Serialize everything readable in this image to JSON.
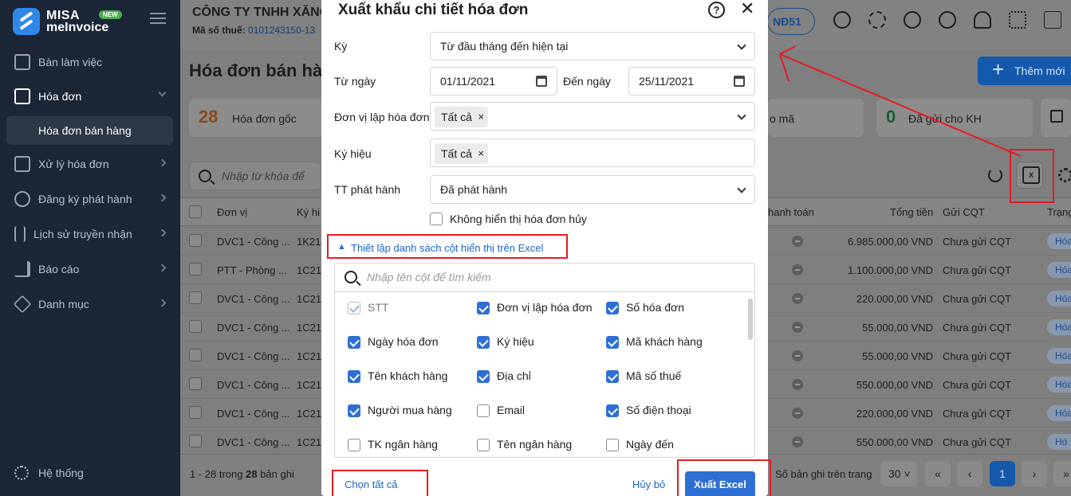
{
  "app": {
    "brand_line1": "MISA",
    "brand_line2": "meInvoice",
    "badge": "NEW"
  },
  "sidebar": {
    "items": [
      {
        "label": "Bàn làm việc",
        "icon": "monitor-icon"
      },
      {
        "label": "Hóa đơn",
        "icon": "document-icon"
      },
      {
        "label": "Xử lý hóa đơn",
        "icon": "edit-doc-icon"
      },
      {
        "label": "Đăng ký phát hành",
        "icon": "stamp-icon"
      },
      {
        "label": "Lịch sử truyền nhận",
        "icon": "transfer-icon"
      },
      {
        "label": "Báo cáo",
        "icon": "bar-chart-icon"
      },
      {
        "label": "Danh mục",
        "icon": "box-icon"
      }
    ],
    "sub_item": "Hóa đơn bán hàng",
    "system": "Hệ thống"
  },
  "header": {
    "company": "CÔNG TY TNHH XĂNG",
    "tax_label": "Mã số thuế:",
    "tax_value": "0101243150-13",
    "nd_label": "NĐ51"
  },
  "page": {
    "title": "Hóa đơn bán hà",
    "add_button": "Thêm mới",
    "search_placeholder": "Nhập từ khóa để tìm"
  },
  "cards": [
    {
      "num": "28",
      "label": "Hóa đơn gốc"
    },
    {
      "label": "o mã"
    },
    {
      "num": "0",
      "label": "Đã gửi cho KH"
    }
  ],
  "table": {
    "headers": {
      "unit": "Đơn vị",
      "symbol": "Ký hi",
      "payment": "hanh toán",
      "total": "Tổng tiền",
      "cqt": "Gửi CQT",
      "status": "Trạng"
    },
    "rows": [
      {
        "unit": "DVC1 - Công ...",
        "symbol": "1K21",
        "total": "6.985.000,00 VND",
        "cqt": "Chưa gửi CQT",
        "status": "Hóa"
      },
      {
        "unit": "PTT - Phòng ...",
        "symbol": "1C21",
        "total": "1.100.000,00 VND",
        "cqt": "Chưa gửi CQT",
        "status": "Hóa"
      },
      {
        "unit": "DVC1 - Công ...",
        "symbol": "1C21",
        "total": "220.000,00 VND",
        "cqt": "Chưa gửi CQT",
        "status": "Hóa"
      },
      {
        "unit": "DVC1 - Công ...",
        "symbol": "1C21",
        "total": "55.000,00 VND",
        "cqt": "Chưa gửi CQT",
        "status": "Hóa"
      },
      {
        "unit": "DVC1 - Công ...",
        "symbol": "1C21",
        "total": "55.000,00 VND",
        "cqt": "Chưa gửi CQT",
        "status": "Hóa"
      },
      {
        "unit": "DVC1 - Công ...",
        "symbol": "1C21",
        "total": "550.000,00 VND",
        "cqt": "Chưa gửi CQT",
        "status": "Hóa"
      },
      {
        "unit": "DVC1 - Công ...",
        "symbol": "1C21",
        "total": "220.000,00 VND",
        "cqt": "Chưa gửi CQT",
        "status": "Hóa"
      },
      {
        "unit": "DVC1 - Công ...",
        "symbol": "1C21",
        "total": "550.000,00 VND",
        "cqt": "Chưa gửi CQT",
        "status": "Hó"
      }
    ]
  },
  "footer": {
    "range": "1 - 28 trong ",
    "count": "28",
    "suffix": " bản ghi",
    "per_page_label": "Số bản ghi trên trang",
    "per_page": "30",
    "current_page": "1"
  },
  "modal": {
    "title": "Xuất khẩu chi tiết hóa đơn",
    "period_label": "Kỳ",
    "period_value": "Từ đầu tháng đến hiện tại",
    "from_label": "Từ ngày",
    "from_value": "01/11/2021",
    "to_label": "Đến ngày",
    "to_value": "25/11/2021",
    "unit_label": "Đơn vị lập hóa đơn",
    "unit_tag": "Tất cả",
    "symbol_label": "Ký hiệu",
    "symbol_tag": "Tất cả",
    "status_label": "TT phát hành",
    "status_value": "Đã phát hành",
    "hide_cancelled": "Không hiển thị hóa đơn hủy",
    "column_setup": "Thiết lập danh sách cột hiển thị trên Excel",
    "column_search_placeholder": "Nhập tên cột để tìm kiếm",
    "columns": [
      {
        "label": "STT",
        "checked": true,
        "disabled": true
      },
      {
        "label": "Đơn vị lập hóa đơn",
        "checked": true
      },
      {
        "label": "Số hóa đơn",
        "checked": true
      },
      {
        "label": "Ngày hóa đơn",
        "checked": true
      },
      {
        "label": "Ký hiệu",
        "checked": true
      },
      {
        "label": "Mã khách hàng",
        "checked": true
      },
      {
        "label": "Tên khách hàng",
        "checked": true
      },
      {
        "label": "Địa chỉ",
        "checked": true
      },
      {
        "label": "Mã số thuế",
        "checked": true
      },
      {
        "label": "Người mua hàng",
        "checked": true
      },
      {
        "label": "Email",
        "checked": false
      },
      {
        "label": "Số điện thoại",
        "checked": true
      },
      {
        "label": "TK ngân hàng",
        "checked": false
      },
      {
        "label": "Tên ngân hàng",
        "checked": false
      },
      {
        "label": "Ngày đến",
        "checked": false
      }
    ],
    "select_all": "Chọn tất cả",
    "cancel": "Hủy bỏ",
    "export": "Xuất Excel",
    "help_glyph": "?",
    "close_glyph": "✕"
  },
  "colors": {
    "primary": "#2e6fd4",
    "annotation": "#e51c23",
    "sidebar": "#1b2636"
  }
}
